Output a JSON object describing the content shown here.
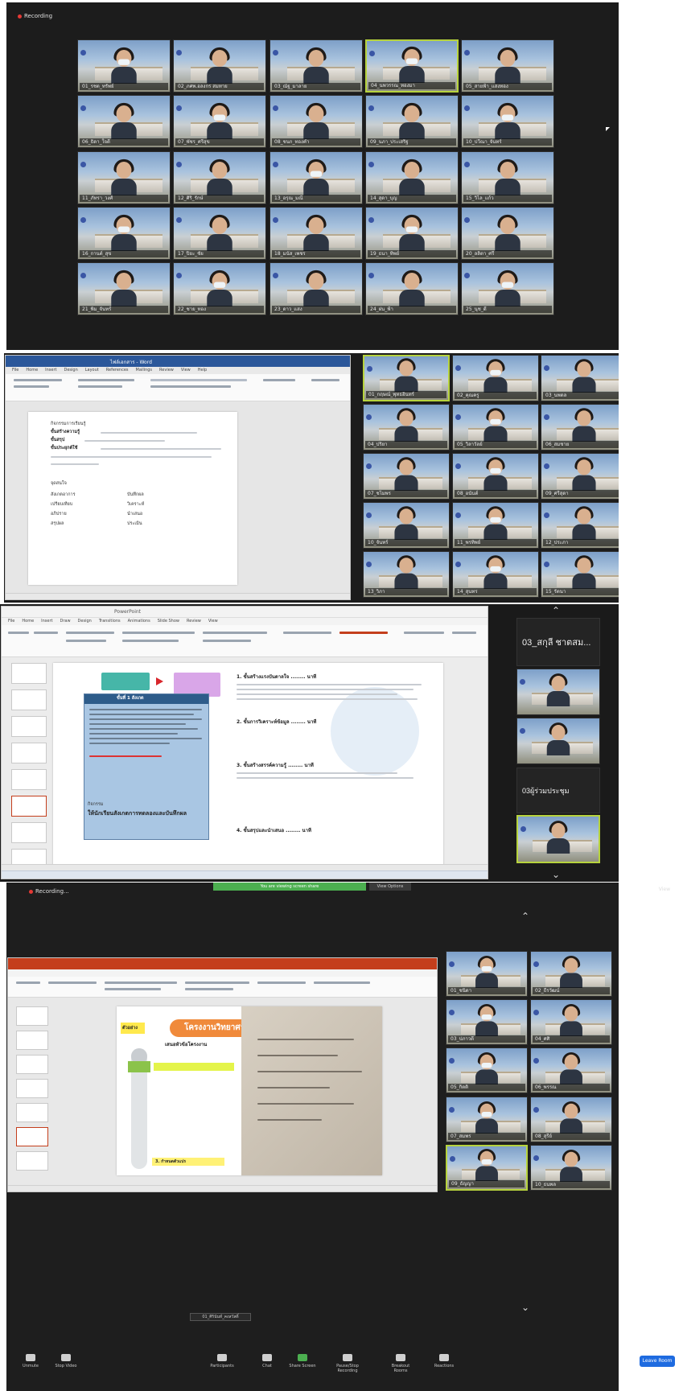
{
  "panel1": {
    "recording_label": "Recording",
    "participants": [
      "01_รชต_ทรัพย์",
      "02_ภศพ.อลงกร สมทาย",
      "03_ณัฐ_มาลาย",
      "04_นพวรรณ_ทองมา",
      "05_สายฟ้า_แสงทอง",
      "06_ธิดา_ใจดี",
      "07_พัชร_ศรีสุข",
      "08_ชนก_ทองคำ",
      "09_นภา_ประเสริฐ",
      "10_ปวีณา_จันทร์",
      "11_ภัทรา_วงศ์",
      "12_ศิริ_รักษ์",
      "13_อรุณ_มณี",
      "14_สุดา_บุญ",
      "15_วิไล_แก้ว",
      "16_กานต์_สุข",
      "17_ปิยะ_ชัย",
      "18_มนัส_เพชร",
      "19_ธนา_ทิพย์",
      "20_ลลิตา_ศรี",
      "21_พิม_จันทร์",
      "22_ชาย_ทอง",
      "23_ดาว_แสง",
      "24_ฝน_ฟ้า",
      "25_นุช_ดี"
    ]
  },
  "panel2": {
    "word_title": "ไฟล์เอกสาร - Word",
    "tabs": [
      "File",
      "Home",
      "Insert",
      "Design",
      "Layout",
      "References",
      "Mailings",
      "Review",
      "View",
      "Help"
    ],
    "doc_heading": "กิจกรรมการเรียนรู้",
    "doc_lines": [
      "ขั้นสร้างความรู้",
      "ขั้นสรุป",
      "ขั้นประยุกต์ใช้"
    ],
    "doc_section": "จุดสนใจ",
    "doc_table": [
      [
        "สังเกตอาการ",
        "บันทึกผล"
      ],
      [
        "เปรียบเทียบ",
        "วิเคราะห์"
      ],
      [
        "อภิปราย",
        "นำเสนอ"
      ],
      [
        "สรุปผล",
        "ประเมิน"
      ]
    ],
    "participants": [
      "01_กฤษณ์_พุทธอินทร์",
      "02_คุณครู",
      "03_นพดล",
      "04_ปริยา",
      "05_วิลาวัลย์",
      "06_สมชาย",
      "07_ชไมพร",
      "08_อนันต์",
      "09_ศรีสุดา",
      "10_จันทร์",
      "11_พรทิพย์",
      "12_ประภา",
      "13_วิภา",
      "14_สุนทร",
      "15_รัตนา"
    ]
  },
  "panel3": {
    "ppt_title": "PowerPoint",
    "tabs": [
      "File",
      "Home",
      "Insert",
      "Draw",
      "Design",
      "Transitions",
      "Animations",
      "Slide Show",
      "Review",
      "View"
    ],
    "slide_box_title": "ขั้นที่ 1 สังเกต",
    "slide_box_label": "กิจกรรม",
    "slide_points": [
      "1. ขั้นสร้างแรงบันดาลใจ ........ นาที",
      "2. ขั้นการวิเคราะห์ข้อมูล ........ นาที",
      "3. ขั้นสร้างสรรค์ความรู้ ........ นาที",
      "4. ขั้นสรุปและนำเสนอ ........ นาที"
    ],
    "slide_bottom_text": "ให้นักเรียนสังเกตการทดลองและบันทึกผล",
    "side_labels": [
      "03_สกุลี ชาตสม...",
      "03ผู้ร่วมประชุม"
    ]
  },
  "panel4": {
    "recording_label": "Recording...",
    "banner_text": "You are viewing screen share",
    "banner2_text": "View Options",
    "view_label": "View",
    "slide_heading": "โครงงานวิทยาศาสตร์",
    "slide_sub": "เสนอหัวข้อโครงงาน",
    "slide_tag": "ตัวอย่าง",
    "slide_bottom": "3. กำหนดตัวแปร",
    "tooltip": "01_ศิรินันท์_คงสวัสดิ์",
    "participants": [
      "01_ชนิดา",
      "02_ธีรวัฒน์",
      "03_ปภาวดี",
      "04_ศศิ",
      "05_กิตติ",
      "06_พรรณ",
      "07_สมพร",
      "08_สุรีย์",
      "09_ธัญญา",
      "10_ธนพล"
    ],
    "controls": [
      "Unmute",
      "Stop Video",
      "Participants",
      "Chat",
      "Share Screen",
      "Pause/Stop Recording",
      "Breakout Rooms",
      "Reactions"
    ],
    "leave_label": "Leave Room"
  },
  "colors": {
    "zoom_bg": "#1c1c1c",
    "active_speaker": "#b7d33d",
    "word_blue": "#2b579a",
    "ppt_red": "#c43e1c",
    "leave_blue": "#1e6be0"
  }
}
